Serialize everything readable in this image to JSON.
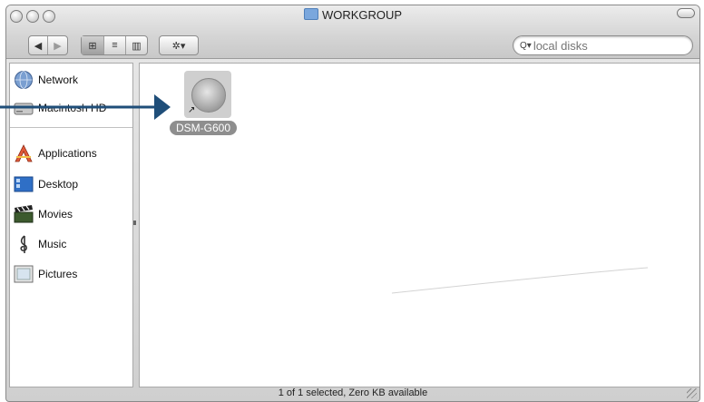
{
  "window": {
    "title": "WORKGROUP",
    "status": "1 of 1 selected, Zero KB available"
  },
  "toolbar": {
    "nav": [
      "◀",
      "▶"
    ],
    "views": [
      "⊞",
      "≡",
      "▥"
    ],
    "selected_view": "icon",
    "action": "✲▾",
    "search_placeholder": "local disks"
  },
  "sidebar": {
    "devices": [
      {
        "label": "Network",
        "icon": "network-globe-icon"
      },
      {
        "label": "Macintosh HD",
        "icon": "hard-disk-icon"
      }
    ],
    "places": [
      {
        "label": "Applications",
        "icon": "applications-icon"
      },
      {
        "label": "Desktop",
        "icon": "desktop-icon"
      },
      {
        "label": "Movies",
        "icon": "movies-clapper-icon"
      },
      {
        "label": "Music",
        "icon": "music-clef-icon"
      },
      {
        "label": "Pictures",
        "icon": "pictures-frame-icon"
      }
    ]
  },
  "content": {
    "items": [
      {
        "label": "DSM-G600",
        "icon": "network-volume-alias-icon",
        "selected": true
      }
    ]
  },
  "annotation": {
    "type": "arrow",
    "color": "#1f4e79"
  }
}
